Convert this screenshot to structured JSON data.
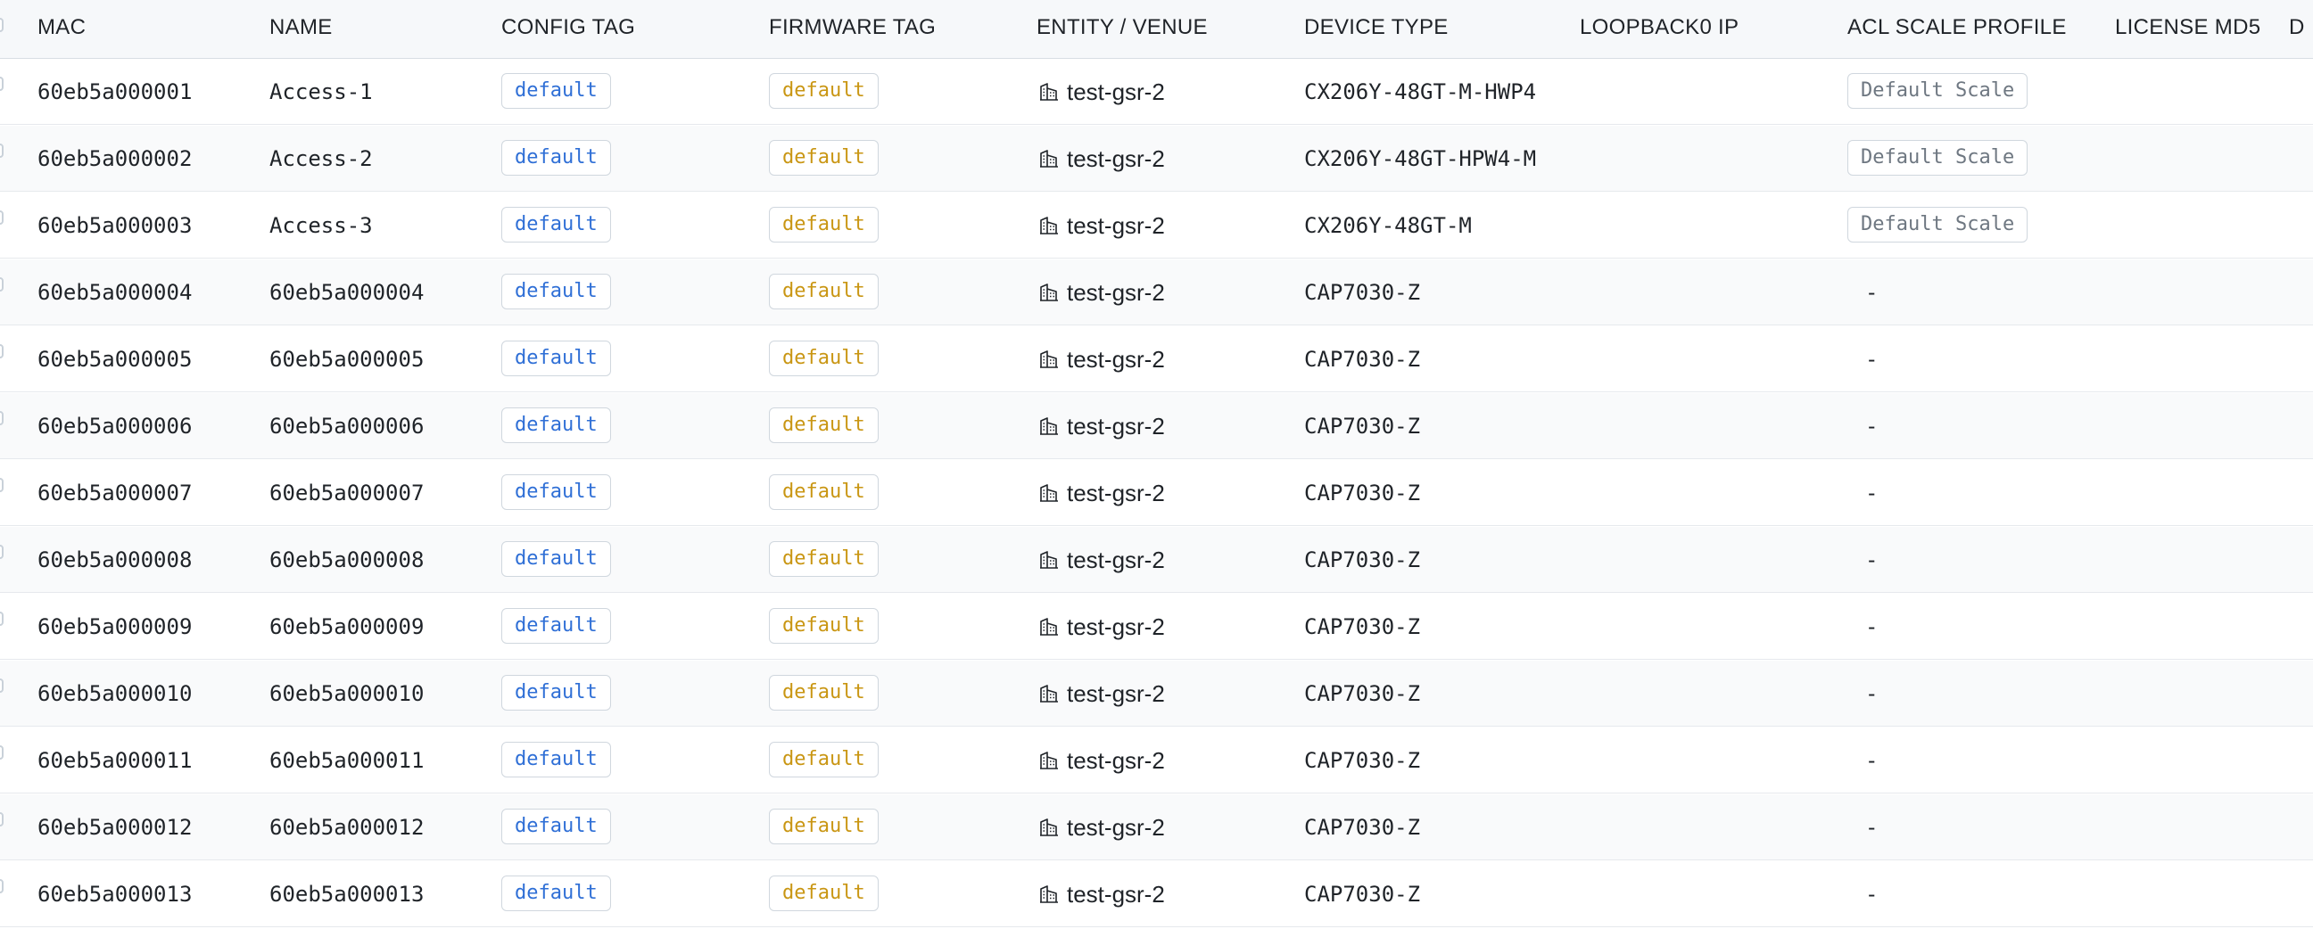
{
  "table": {
    "columns": [
      "MAC",
      "NAME",
      "CONFIG TAG",
      "FIRMWARE TAG",
      "ENTITY / VENUE",
      "DEVICE TYPE",
      "LOOPBACK0 IP",
      "ACL SCALE PROFILE",
      "LICENSE MD5",
      "D"
    ],
    "rows": [
      {
        "mac": "60eb5a000001",
        "name": "Access-1",
        "config_tag": "default",
        "firmware_tag": "default",
        "venue": "test-gsr-2",
        "device_type": "CX206Y-48GT-M-HWP4",
        "loopback0_ip": "",
        "acl_scale_profile": "Default Scale"
      },
      {
        "mac": "60eb5a000002",
        "name": "Access-2",
        "config_tag": "default",
        "firmware_tag": "default",
        "venue": "test-gsr-2",
        "device_type": "CX206Y-48GT-HPW4-M",
        "loopback0_ip": "",
        "acl_scale_profile": "Default Scale"
      },
      {
        "mac": "60eb5a000003",
        "name": "Access-3",
        "config_tag": "default",
        "firmware_tag": "default",
        "venue": "test-gsr-2",
        "device_type": "CX206Y-48GT-M",
        "loopback0_ip": "",
        "acl_scale_profile": "Default Scale"
      },
      {
        "mac": "60eb5a000004",
        "name": "60eb5a000004",
        "config_tag": "default",
        "firmware_tag": "default",
        "venue": "test-gsr-2",
        "device_type": "CAP7030-Z",
        "loopback0_ip": "-",
        "acl_scale_profile": ""
      },
      {
        "mac": "60eb5a000005",
        "name": "60eb5a000005",
        "config_tag": "default",
        "firmware_tag": "default",
        "venue": "test-gsr-2",
        "device_type": "CAP7030-Z",
        "loopback0_ip": "-",
        "acl_scale_profile": ""
      },
      {
        "mac": "60eb5a000006",
        "name": "60eb5a000006",
        "config_tag": "default",
        "firmware_tag": "default",
        "venue": "test-gsr-2",
        "device_type": "CAP7030-Z",
        "loopback0_ip": "-",
        "acl_scale_profile": ""
      },
      {
        "mac": "60eb5a000007",
        "name": "60eb5a000007",
        "config_tag": "default",
        "firmware_tag": "default",
        "venue": "test-gsr-2",
        "device_type": "CAP7030-Z",
        "loopback0_ip": "-",
        "acl_scale_profile": ""
      },
      {
        "mac": "60eb5a000008",
        "name": "60eb5a000008",
        "config_tag": "default",
        "firmware_tag": "default",
        "venue": "test-gsr-2",
        "device_type": "CAP7030-Z",
        "loopback0_ip": "-",
        "acl_scale_profile": ""
      },
      {
        "mac": "60eb5a000009",
        "name": "60eb5a000009",
        "config_tag": "default",
        "firmware_tag": "default",
        "venue": "test-gsr-2",
        "device_type": "CAP7030-Z",
        "loopback0_ip": "-",
        "acl_scale_profile": ""
      },
      {
        "mac": "60eb5a000010",
        "name": "60eb5a000010",
        "config_tag": "default",
        "firmware_tag": "default",
        "venue": "test-gsr-2",
        "device_type": "CAP7030-Z",
        "loopback0_ip": "-",
        "acl_scale_profile": ""
      },
      {
        "mac": "60eb5a000011",
        "name": "60eb5a000011",
        "config_tag": "default",
        "firmware_tag": "default",
        "venue": "test-gsr-2",
        "device_type": "CAP7030-Z",
        "loopback0_ip": "-",
        "acl_scale_profile": ""
      },
      {
        "mac": "60eb5a000012",
        "name": "60eb5a000012",
        "config_tag": "default",
        "firmware_tag": "default",
        "venue": "test-gsr-2",
        "device_type": "CAP7030-Z",
        "loopback0_ip": "-",
        "acl_scale_profile": ""
      },
      {
        "mac": "60eb5a000013",
        "name": "60eb5a000013",
        "config_tag": "default",
        "firmware_tag": "default",
        "venue": "test-gsr-2",
        "device_type": "CAP7030-Z",
        "loopback0_ip": "-",
        "acl_scale_profile": ""
      }
    ]
  },
  "icons": {
    "venue": "building-icon",
    "row_select": "checkbox-icon"
  },
  "colors": {
    "config_tag": "#2f6fd6",
    "firmware_tag": "#c99613",
    "scale_tag": "#6e7781",
    "header_bg": "#f6f8fa",
    "border": "#d8dee4"
  }
}
